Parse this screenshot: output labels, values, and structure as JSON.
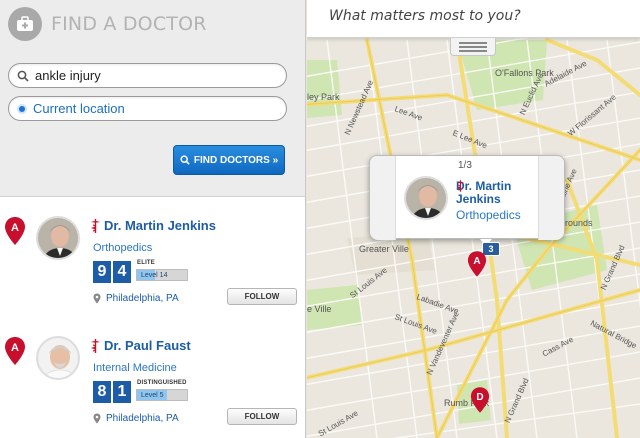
{
  "app": {
    "title": "FIND A DOCTOR"
  },
  "search": {
    "query": "ankle injury",
    "location": "Current location",
    "button_label": "FIND DOCTORS »"
  },
  "doctors": [
    {
      "pin": "A",
      "name": "Dr. Martin Jenkins",
      "specialty": "Orthopedics",
      "score_digits": [
        "9",
        "4"
      ],
      "tier": "ELITE",
      "level_label": "Level 14",
      "level_progress": 0.35,
      "location": "Philadelphia, PA",
      "follow_label": "FOLLOW"
    },
    {
      "pin": "A",
      "name": "Dr. Paul Faust",
      "specialty": "Internal Medicine",
      "score_digits": [
        "8",
        "1"
      ],
      "tier": "DISTINGUISHED",
      "level_label": "Level 5",
      "level_progress": 0.6,
      "location": "Philadelphia, PA",
      "follow_label": "FOLLOW"
    }
  ],
  "map": {
    "question": "What matters most to you?",
    "popup": {
      "count": "1/3",
      "name": "Dr. Martin Jenkins",
      "specialty": "Orthopedics"
    },
    "cluster_count": "3",
    "pins": [
      "A",
      "D"
    ],
    "places": {
      "ofallons_park": "O'Fallons Park",
      "ley_park": "ley Park",
      "greater_ville": "Greater Ville",
      "e_ville": "e Ville",
      "grounds": "rounds",
      "rumbold_park": "Rumb Park"
    },
    "streets": {
      "lee_ave": "Lee Ave",
      "e_lee_ave": "E Lee Ave",
      "n_newstead": "N Newstead Ave",
      "n_euclid": "N Euclid Ave",
      "adelaide": "Adelaide Ave",
      "w_florissant": "W Florissant Ave",
      "prairie": "Prairie Ave",
      "n_grand": "N Grand Blvd",
      "natural_bridge": "Natural Bridge",
      "st_louis_ave_1": "St Louis Ave",
      "st_louis_ave_2": "St Louis Ave",
      "labadie": "Labadie Ave",
      "n_vandeventer": "N Vandeventer Ave",
      "cass": "Cass Ave",
      "n_grand_2": "N Grand Blvd",
      "st_louis_3": "St Louis Ave"
    }
  },
  "colors": {
    "brand_blue": "#1d5da8",
    "button_blue": "#1a74d8",
    "pin_red": "#c8102e",
    "map_bg": "#e9e5dc",
    "road_yellow": "#f5df7a"
  }
}
